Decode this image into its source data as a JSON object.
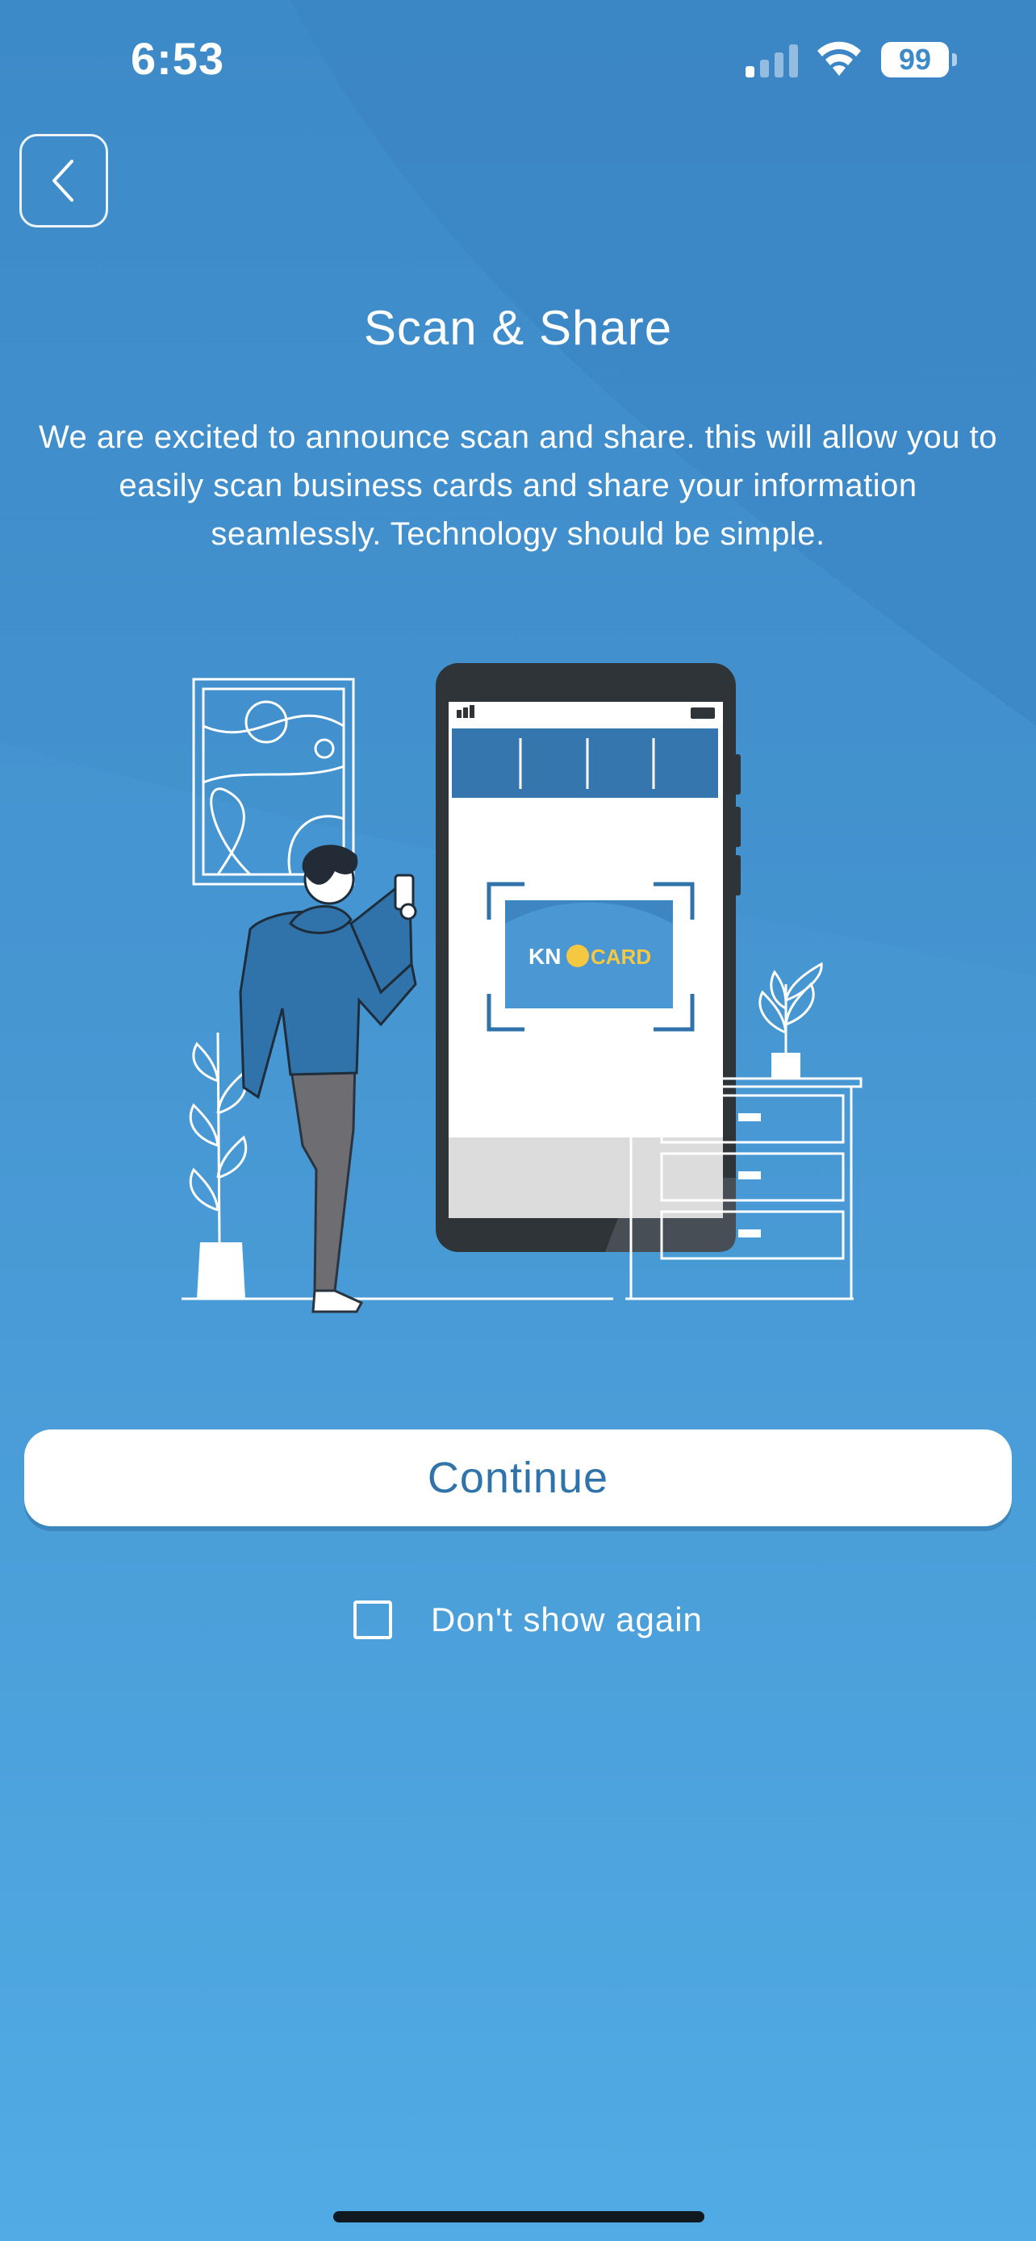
{
  "status_bar": {
    "time": "6:53",
    "battery": "99"
  },
  "icons": {
    "back": "chevron-left-icon",
    "signal": "cellular-signal-icon",
    "wifi": "wifi-icon",
    "battery": "battery-icon",
    "checkbox": "checkbox-unchecked-icon"
  },
  "colors": {
    "background_top": "#3d8ac8",
    "background_bottom": "#55b4ec",
    "button_text": "#2f73aa",
    "card_yellow": "#f5c842"
  },
  "header": {
    "title": "Scan & Share"
  },
  "main": {
    "description": "We are excited to announce scan and share. this will allow you to easily scan business cards and share your information seamlessly. Technology should be simple.",
    "illustration": {
      "card_logo_left": "KN",
      "card_logo_right": "CARD"
    },
    "continue_label": "Continue",
    "dont_show_again_label": "Don't show again",
    "dont_show_again_checked": false
  }
}
